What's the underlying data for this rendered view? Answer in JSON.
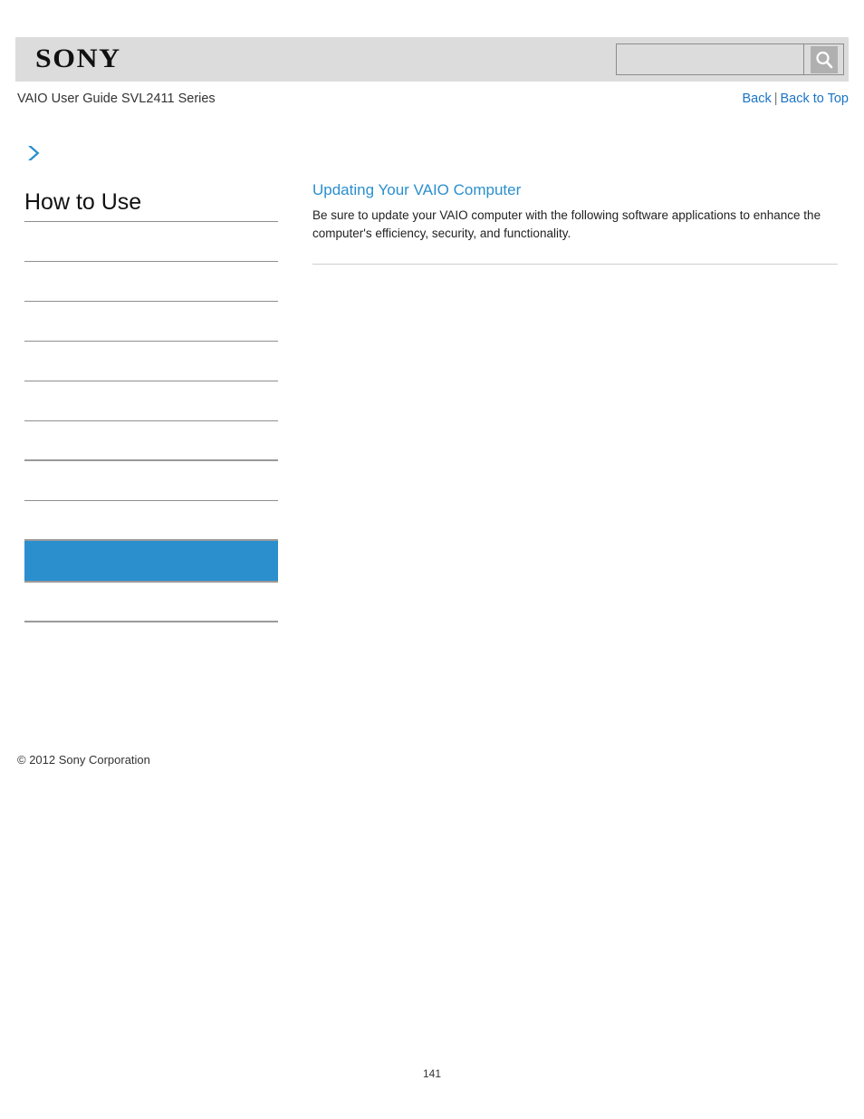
{
  "header": {
    "logo_text": "SONY",
    "logo_icon": "sony-wordmark",
    "search": {
      "value": "",
      "placeholder": "",
      "icon": "search-icon",
      "button_label": ""
    }
  },
  "subheader": {
    "guide_title": "VAIO User Guide SVL2411 Series",
    "links": {
      "back": "Back",
      "separator": "|",
      "back_to_top": "Back to Top"
    }
  },
  "sidebar": {
    "expand_icon": "chevron-right-icon",
    "heading": "How to Use",
    "items": [
      {
        "label": "",
        "style": "normal"
      },
      {
        "label": "",
        "style": "normal"
      },
      {
        "label": "",
        "style": "normal"
      },
      {
        "label": "",
        "style": "normal"
      },
      {
        "label": "",
        "style": "normal"
      },
      {
        "label": "",
        "style": "thick"
      },
      {
        "label": "",
        "style": "normal"
      },
      {
        "label": "",
        "style": "thick"
      },
      {
        "label": "",
        "style": "active"
      },
      {
        "label": "",
        "style": "thick"
      }
    ],
    "copyright": "© 2012 Sony Corporation"
  },
  "main": {
    "title": "Updating Your VAIO Computer",
    "body": "Be sure to update your VAIO computer with the following software applications to enhance the computer's efficiency, security, and functionality."
  },
  "footer": {
    "page_number": "141"
  },
  "colors": {
    "accent_blue": "#2b8fce",
    "link_blue": "#1a74c6",
    "header_grey": "#dcdcdc",
    "divider_grey": "#8f8f8f"
  }
}
